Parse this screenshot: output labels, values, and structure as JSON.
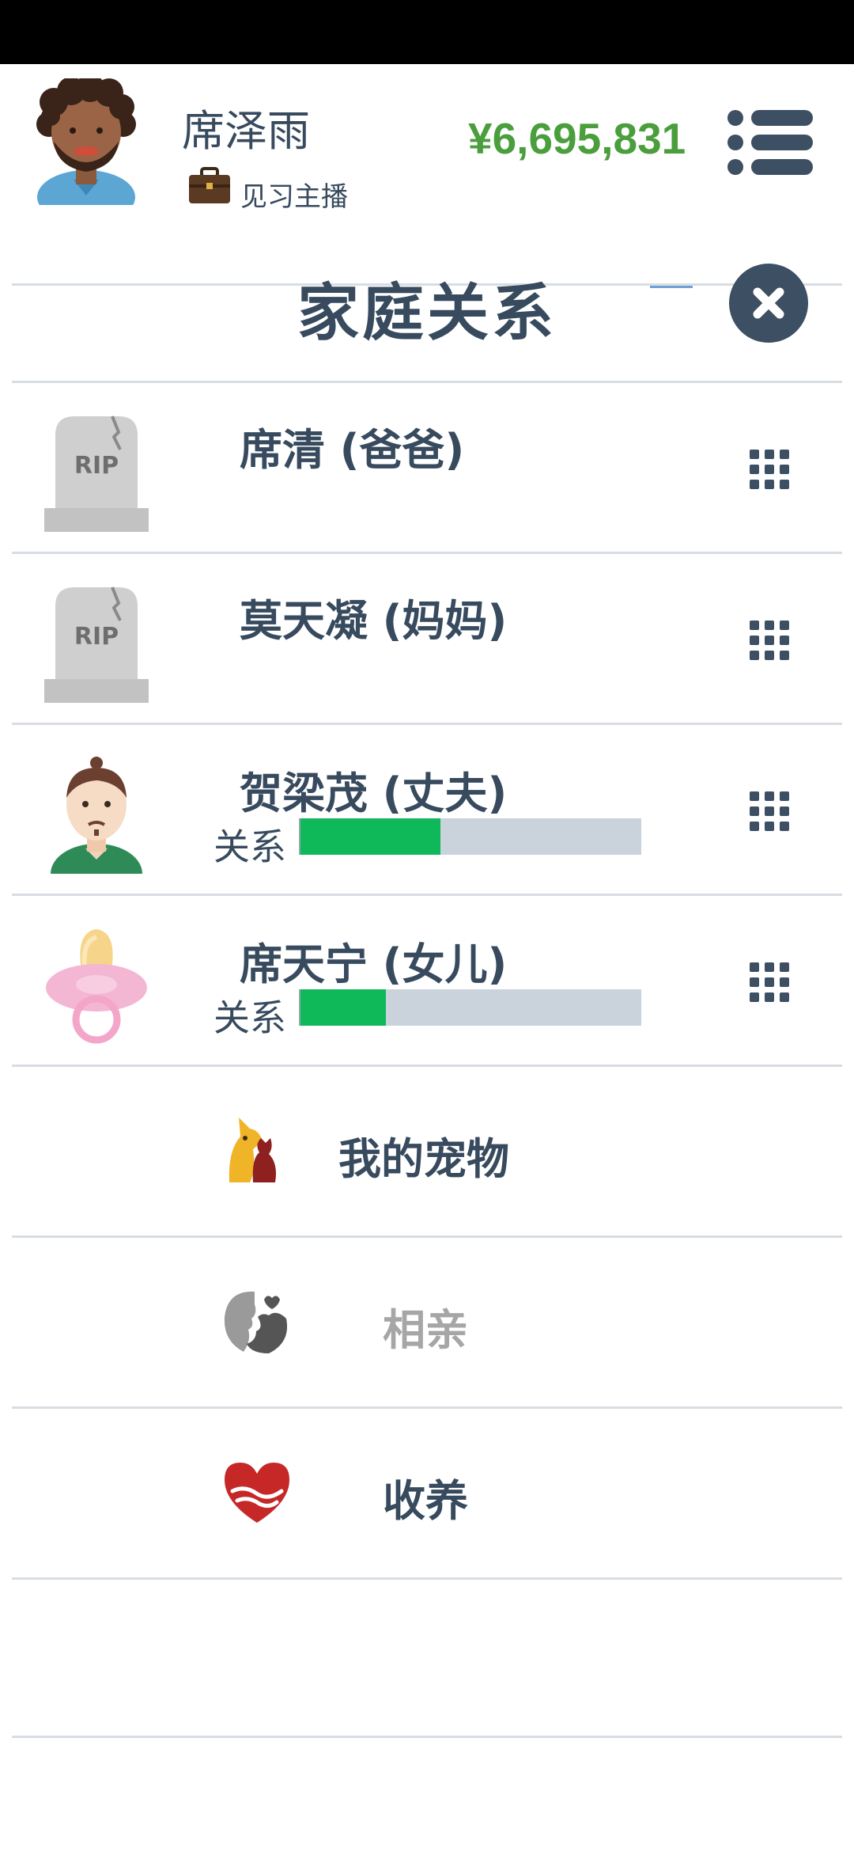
{
  "header": {
    "user_name": "席泽雨",
    "job_title": "见习主播",
    "money": "¥6,695,831",
    "avatar_icon": "curly-hair-man-avatar",
    "job_icon": "briefcase-icon",
    "menu_icon": "list-menu-icon"
  },
  "page": {
    "title": "家庭关系",
    "close_icon": "close-icon"
  },
  "family": [
    {
      "name": "席清 (爸爸)",
      "icon": "tombstone-icon",
      "icon_text": "RIP",
      "deceased": true
    },
    {
      "name": "莫天凝 (妈妈)",
      "icon": "tombstone-icon",
      "icon_text": "RIP",
      "deceased": true
    },
    {
      "name": "贺梁茂 (丈夫)",
      "icon": "man-avatar-icon",
      "relation_label": "关系",
      "relation_level": 0.41
    },
    {
      "name": "席天宁 (女儿)",
      "icon": "pacifier-icon",
      "relation_label": "关系",
      "relation_level": 0.25
    }
  ],
  "actions": [
    {
      "label": "我的宠物",
      "icon": "pet-icon",
      "enabled": true
    },
    {
      "label": "相亲",
      "icon": "couple-kiss-icon",
      "enabled": false
    },
    {
      "label": "收养",
      "icon": "heart-hug-icon",
      "enabled": true
    }
  ],
  "colors": {
    "text": "#374a5e",
    "money": "#4a9e3c",
    "relation_fill": "#0fb95a",
    "relation_track": "#cad3dc",
    "disabled_text": "#a6a6a6"
  }
}
